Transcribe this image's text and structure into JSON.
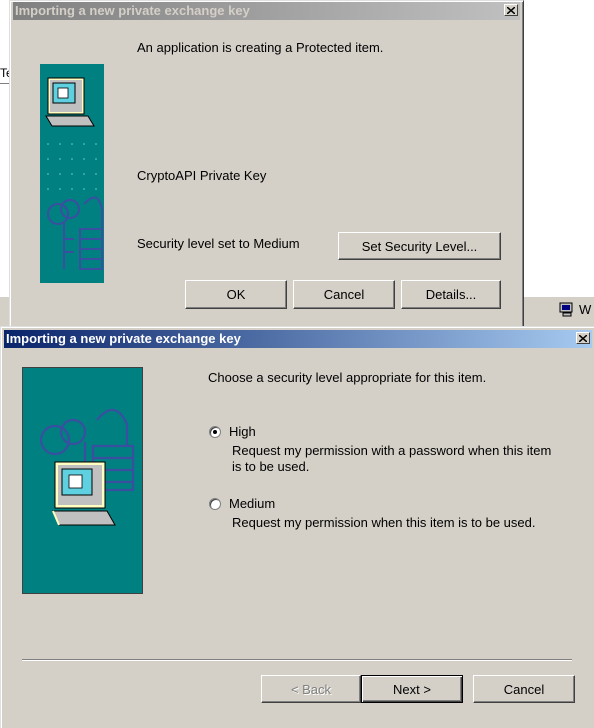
{
  "background": {
    "left_text": "Te",
    "tray_text": "W"
  },
  "dialog_back": {
    "title": "Importing a new private exchange key",
    "message": "An application is creating a Protected item.",
    "item_name": "CryptoAPI Private Key",
    "security_status": "Security level set to Medium",
    "set_security_button": "Set Security Level...",
    "ok_button": "OK",
    "cancel_button": "Cancel",
    "details_button": "Details..."
  },
  "dialog_front": {
    "title": "Importing a new private exchange key",
    "prompt": "Choose a security level appropriate for this item.",
    "options": [
      {
        "label": "High",
        "desc_line1": "Request my permission with a password when this item",
        "desc_line2": "is to be used.",
        "selected": true
      },
      {
        "label": "Medium",
        "desc_line1": "Request my permission when this item is to be used.",
        "desc_line2": "",
        "selected": false
      }
    ],
    "back_button": "< Back",
    "next_button": "Next >",
    "cancel_button": "Cancel"
  },
  "colors": {
    "panel_teal": "#008080",
    "dialog_gray": "#d4d0c8",
    "active_title": "#0a246a",
    "inactive_title": "#808080"
  }
}
